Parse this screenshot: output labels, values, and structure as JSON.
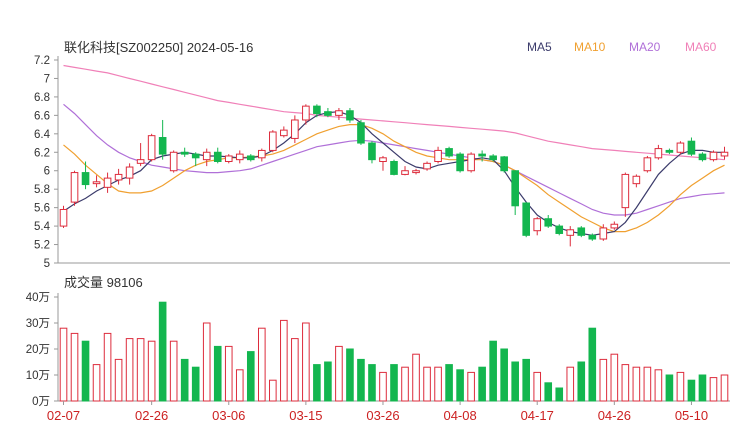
{
  "chart_data": {
    "type": "candlestick",
    "title": "联化科技[SZ002250] 2024-05-16",
    "volume_title": "成交量 98106",
    "legend": [
      {
        "name": "MA5",
        "color": "#3b3b6b"
      },
      {
        "name": "MA10",
        "color": "#f0a030"
      },
      {
        "name": "MA20",
        "color": "#b070d8"
      },
      {
        "name": "MA60",
        "color": "#f080b8"
      }
    ],
    "colors": {
      "up": "#dd2c3c",
      "down": "#13b64f",
      "axis": "#999999",
      "date_text": "#cc2222"
    },
    "price_axis": {
      "min": 5.0,
      "max": 7.2,
      "ticks": [
        "7.2",
        "7",
        "6.8",
        "6.6",
        "6.4",
        "6.2",
        "6",
        "5.8",
        "5.6",
        "5.4",
        "5.2",
        "5"
      ]
    },
    "volume_axis": {
      "min": 0,
      "max": 40,
      "ticks": [
        "40万",
        "30万",
        "20万",
        "10万",
        "0万"
      ]
    },
    "x_labels": [
      {
        "label": "02-07",
        "index": 0
      },
      {
        "label": "02-26",
        "index": 8
      },
      {
        "label": "03-06",
        "index": 15
      },
      {
        "label": "03-15",
        "index": 22
      },
      {
        "label": "03-26",
        "index": 29
      },
      {
        "label": "04-08",
        "index": 36
      },
      {
        "label": "04-17",
        "index": 43
      },
      {
        "label": "04-26",
        "index": 50
      },
      {
        "label": "05-10",
        "index": 57
      }
    ],
    "ohlc": [
      [
        5.4,
        5.58,
        5.62,
        5.38
      ],
      [
        5.66,
        5.98,
        6.0,
        5.62
      ],
      [
        5.98,
        5.85,
        6.1,
        5.8
      ],
      [
        5.86,
        5.88,
        5.95,
        5.82
      ],
      [
        5.82,
        5.92,
        5.98,
        5.76
      ],
      [
        5.9,
        5.96,
        6.02,
        5.85
      ],
      [
        5.92,
        6.04,
        6.08,
        5.85
      ],
      [
        6.08,
        6.12,
        6.3,
        6.05
      ],
      [
        6.12,
        6.38,
        6.4,
        6.1
      ],
      [
        6.36,
        6.18,
        6.55,
        6.12
      ],
      [
        6.0,
        6.2,
        6.22,
        5.98
      ],
      [
        6.2,
        6.18,
        6.25,
        6.15
      ],
      [
        6.18,
        6.14,
        6.2,
        6.05
      ],
      [
        6.12,
        6.2,
        6.24,
        6.05
      ],
      [
        6.2,
        6.1,
        6.25,
        6.08
      ],
      [
        6.1,
        6.16,
        6.18,
        6.08
      ],
      [
        6.12,
        6.18,
        6.22,
        6.08
      ],
      [
        6.16,
        6.12,
        6.18,
        6.1
      ],
      [
        6.14,
        6.22,
        6.24,
        6.1
      ],
      [
        6.22,
        6.42,
        6.44,
        6.2
      ],
      [
        6.38,
        6.44,
        6.48,
        6.36
      ],
      [
        6.35,
        6.55,
        6.6,
        6.3
      ],
      [
        6.55,
        6.7,
        6.72,
        6.5
      ],
      [
        6.7,
        6.62,
        6.72,
        6.58
      ],
      [
        6.64,
        6.6,
        6.68,
        6.58
      ],
      [
        6.6,
        6.65,
        6.68,
        6.55
      ],
      [
        6.65,
        6.55,
        6.68,
        6.52
      ],
      [
        6.52,
        6.3,
        6.55,
        6.28
      ],
      [
        6.3,
        6.12,
        6.32,
        6.08
      ],
      [
        6.1,
        6.14,
        6.16,
        6.0
      ],
      [
        6.1,
        5.96,
        6.12,
        5.95
      ],
      [
        5.96,
        6.0,
        6.05,
        5.95
      ],
      [
        5.98,
        6.0,
        6.02,
        5.96
      ],
      [
        6.02,
        6.08,
        6.1,
        6.0
      ],
      [
        6.1,
        6.22,
        6.26,
        6.08
      ],
      [
        6.24,
        6.16,
        6.26,
        6.14
      ],
      [
        6.18,
        6.0,
        6.2,
        5.98
      ],
      [
        6.0,
        6.18,
        6.2,
        5.98
      ],
      [
        6.18,
        6.16,
        6.22,
        6.1
      ],
      [
        6.16,
        6.12,
        6.18,
        6.1
      ],
      [
        6.15,
        6.0,
        6.16,
        5.98
      ],
      [
        6.0,
        5.62,
        6.0,
        5.52
      ],
      [
        5.65,
        5.3,
        5.66,
        5.28
      ],
      [
        5.35,
        5.48,
        5.5,
        5.3
      ],
      [
        5.48,
        5.4,
        5.52,
        5.38
      ],
      [
        5.4,
        5.32,
        5.42,
        5.3
      ],
      [
        5.3,
        5.36,
        5.4,
        5.18
      ],
      [
        5.38,
        5.3,
        5.4,
        5.28
      ],
      [
        5.3,
        5.26,
        5.32,
        5.24
      ],
      [
        5.26,
        5.38,
        5.42,
        5.24
      ],
      [
        5.38,
        5.42,
        5.45,
        5.36
      ],
      [
        5.6,
        5.96,
        5.98,
        5.5
      ],
      [
        5.86,
        5.94,
        5.96,
        5.82
      ],
      [
        6.0,
        6.14,
        6.16,
        5.98
      ],
      [
        6.14,
        6.24,
        6.28,
        6.12
      ],
      [
        6.22,
        6.2,
        6.24,
        6.18
      ],
      [
        6.2,
        6.3,
        6.32,
        6.18
      ],
      [
        6.32,
        6.18,
        6.36,
        6.16
      ],
      [
        6.18,
        6.12,
        6.2,
        6.1
      ],
      [
        6.12,
        6.2,
        6.22,
        6.1
      ],
      [
        6.16,
        6.2,
        6.26,
        6.12
      ]
    ],
    "volume": [
      28,
      26,
      23,
      14,
      26,
      16,
      24,
      24,
      23,
      38,
      23,
      16,
      13,
      30,
      21,
      21,
      12,
      19,
      28,
      8,
      31,
      24,
      30,
      14,
      15,
      21,
      20,
      16,
      14,
      11,
      14,
      13,
      18,
      13,
      13,
      14,
      12,
      11,
      13,
      23,
      20,
      15,
      16,
      11,
      7,
      5,
      13,
      15,
      28,
      16,
      18,
      14,
      13,
      13,
      12,
      10,
      11,
      8,
      10,
      9,
      10
    ],
    "ma5": [
      5.56,
      5.64,
      5.7,
      5.78,
      5.84,
      5.9,
      5.94,
      6.0,
      6.12,
      6.16,
      6.18,
      6.2,
      6.18,
      6.16,
      6.16,
      6.15,
      6.14,
      6.14,
      6.16,
      6.22,
      6.3,
      6.4,
      6.52,
      6.6,
      6.63,
      6.64,
      6.6,
      6.52,
      6.4,
      6.3,
      6.2,
      6.1,
      6.04,
      6.02,
      6.06,
      6.08,
      6.1,
      6.12,
      6.14,
      6.12,
      6.0,
      5.82,
      5.66,
      5.52,
      5.44,
      5.38,
      5.34,
      5.32,
      5.3,
      5.32,
      5.34,
      5.44,
      5.6,
      5.78,
      5.96,
      6.08,
      6.18,
      6.22,
      6.22,
      6.2,
      6.2
    ],
    "ma10": [
      6.28,
      6.18,
      6.06,
      5.96,
      5.86,
      5.78,
      5.76,
      5.76,
      5.78,
      5.84,
      5.92,
      6.0,
      6.06,
      6.1,
      6.12,
      6.14,
      6.14,
      6.15,
      6.16,
      6.18,
      6.22,
      6.28,
      6.34,
      6.4,
      6.44,
      6.48,
      6.5,
      6.5,
      6.46,
      6.4,
      6.32,
      6.26,
      6.2,
      6.16,
      6.14,
      6.12,
      6.12,
      6.12,
      6.12,
      6.1,
      6.06,
      6.0,
      5.92,
      5.84,
      5.74,
      5.66,
      5.58,
      5.5,
      5.44,
      5.38,
      5.34,
      5.34,
      5.38,
      5.44,
      5.52,
      5.62,
      5.74,
      5.84,
      5.92,
      6.0,
      6.06
    ],
    "ma20": [
      6.72,
      6.62,
      6.5,
      6.38,
      6.28,
      6.2,
      6.14,
      6.1,
      6.06,
      6.04,
      6.02,
      6.0,
      5.99,
      5.98,
      5.98,
      5.99,
      6.0,
      6.02,
      6.06,
      6.1,
      6.14,
      6.18,
      6.22,
      6.26,
      6.28,
      6.3,
      6.32,
      6.33,
      6.32,
      6.3,
      6.28,
      6.26,
      6.24,
      6.22,
      6.2,
      6.18,
      6.16,
      6.14,
      6.12,
      6.1,
      6.06,
      6.0,
      5.94,
      5.88,
      5.82,
      5.76,
      5.7,
      5.64,
      5.58,
      5.54,
      5.52,
      5.52,
      5.54,
      5.58,
      5.62,
      5.66,
      5.7,
      5.72,
      5.74,
      5.75,
      5.76
    ],
    "ma60": [
      7.14,
      7.12,
      7.1,
      7.08,
      7.06,
      7.03,
      7.0,
      6.97,
      6.94,
      6.91,
      6.88,
      6.85,
      6.82,
      6.79,
      6.76,
      6.74,
      6.72,
      6.7,
      6.68,
      6.66,
      6.64,
      6.63,
      6.62,
      6.6,
      6.59,
      6.58,
      6.57,
      6.56,
      6.55,
      6.54,
      6.53,
      6.52,
      6.51,
      6.5,
      6.49,
      6.48,
      6.47,
      6.46,
      6.45,
      6.44,
      6.43,
      6.41,
      6.38,
      6.35,
      6.32,
      6.3,
      6.28,
      6.26,
      6.24,
      6.23,
      6.22,
      6.21,
      6.2,
      6.19,
      6.18,
      6.17,
      6.16,
      6.15,
      6.14,
      6.13,
      6.12
    ]
  }
}
